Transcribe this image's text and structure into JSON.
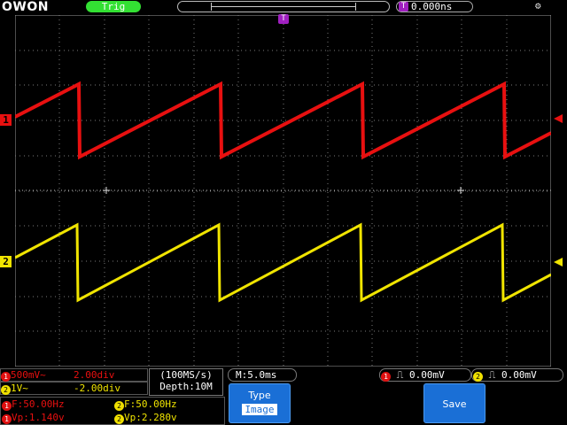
{
  "header": {
    "brand": "OWON",
    "trigger_status": "Trig",
    "trigger_position_badge": "T",
    "trigger_position": "0.000ns",
    "control_icon": "gear-icon"
  },
  "screen": {
    "ch1_marker": "1",
    "ch2_marker": "2",
    "trigger_marker_badge": "T",
    "colors": {
      "ch1": "#e81010",
      "ch2": "#f0e400",
      "grid": "#808080",
      "trigger": "#a020c0"
    }
  },
  "bottom": {
    "ch1_scale": "500mV~",
    "ch1_offset": "2.00div",
    "ch2_scale": "1V~",
    "ch2_offset": "-2.00div",
    "sample_rate": "(100MS/s)",
    "depth": "Depth:10M",
    "timebase": "M:5.0ms",
    "ch1_trigger_level": "0.00mV",
    "ch2_trigger_level": "0.00mV",
    "ch1_freq": "F:50.00Hz",
    "ch1_vp": "Vp:1.140v",
    "ch2_freq": "F:50.00Hz",
    "ch2_vp": "Vp:2.280v",
    "badge_1": "1",
    "badge_2": "2",
    "type_label": "Type",
    "type_value": "Image",
    "save_label": "Save"
  }
}
